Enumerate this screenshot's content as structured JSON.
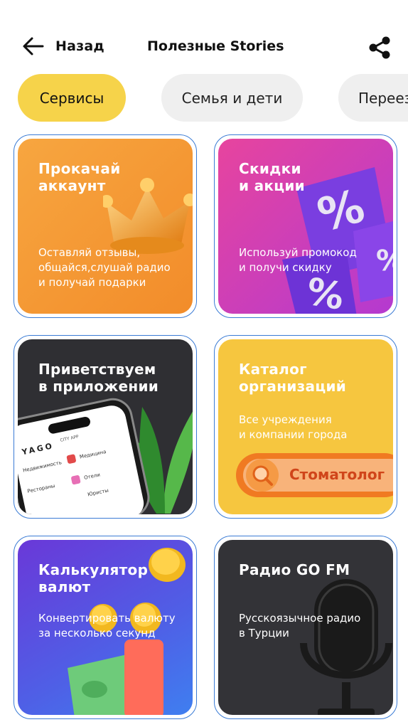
{
  "header": {
    "back_label": "Назад",
    "title": "Полезные Stories"
  },
  "tabs": [
    {
      "label": "Сервисы",
      "active": true
    },
    {
      "label": "Семья и дети",
      "active": false
    },
    {
      "label": "Переезд",
      "active": false
    }
  ],
  "cards": [
    {
      "title": "Прокачай\nаккаунт",
      "desc": "Оставляй отзывы,\nобщайся,слушай радио\nи получай подарки",
      "art": "crown-icon"
    },
    {
      "title": "Скидки\nи акции",
      "desc": "Используй промокод\nи получи скидку",
      "art": "percent-tiles"
    },
    {
      "title": "Приветствуем\nв приложении",
      "desc": "",
      "art": "phone-mockup",
      "phone": {
        "logo": "YAGO",
        "logo_sub": "CITY APP",
        "items": [
          "Недвижимость",
          "Медицина",
          "Рестораны",
          "Отели",
          "Юристы"
        ]
      }
    },
    {
      "title": "Каталог\nорганизаций",
      "desc": "Все учреждения\nи компании города",
      "art": "search-bar",
      "search_text": "Стоматолог"
    },
    {
      "title": "Калькулятор\nвалют",
      "desc": "Конвертировать валюту\nза несколько секунд",
      "art": "coins-money"
    },
    {
      "title": "Радио GO FM",
      "desc": "Русскоязычное радио\nв Турции",
      "art": "microphone"
    }
  ],
  "colors": {
    "accent_tab": "#f6d34a",
    "card_border": "#3a7bd5"
  }
}
